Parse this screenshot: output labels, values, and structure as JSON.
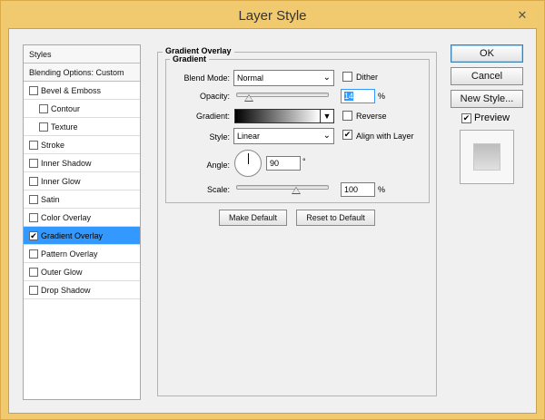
{
  "window": {
    "title": "Layer Style",
    "close_glyph": "✕"
  },
  "left_list": {
    "styles_header": "Styles",
    "blending_header": "Blending Options: Custom",
    "items": [
      {
        "label": "Bevel & Emboss",
        "checked": false,
        "indent": false
      },
      {
        "label": "Contour",
        "checked": false,
        "indent": true
      },
      {
        "label": "Texture",
        "checked": false,
        "indent": true
      },
      {
        "label": "Stroke",
        "checked": false,
        "indent": false
      },
      {
        "label": "Inner Shadow",
        "checked": false,
        "indent": false
      },
      {
        "label": "Inner Glow",
        "checked": false,
        "indent": false
      },
      {
        "label": "Satin",
        "checked": false,
        "indent": false
      },
      {
        "label": "Color Overlay",
        "checked": false,
        "indent": false
      },
      {
        "label": "Gradient Overlay",
        "checked": true,
        "indent": false,
        "selected": true
      },
      {
        "label": "Pattern Overlay",
        "checked": false,
        "indent": false
      },
      {
        "label": "Outer Glow",
        "checked": false,
        "indent": false
      },
      {
        "label": "Drop Shadow",
        "checked": false,
        "indent": false
      }
    ],
    "check_glyph": "✔"
  },
  "panel": {
    "title": "Gradient Overlay",
    "group": "Gradient",
    "blend_mode_label": "Blend Mode:",
    "blend_mode_value": "Normal",
    "dither_label": "Dither",
    "dither_checked": false,
    "opacity_label": "Opacity:",
    "opacity_value": "14",
    "opacity_fraction": 0.14,
    "percent": "%",
    "gradient_label": "Gradient:",
    "reverse_label": "Reverse",
    "reverse_checked": false,
    "style_label": "Style:",
    "style_value": "Linear",
    "align_label": "Align with Layer",
    "align_checked": true,
    "angle_label": "Angle:",
    "angle_value": "90",
    "degree": "°",
    "scale_label": "Scale:",
    "scale_value": "100",
    "scale_fraction": 0.5,
    "make_default": "Make Default",
    "reset_default": "Reset to Default"
  },
  "actions": {
    "ok": "OK",
    "cancel": "Cancel",
    "new_style": "New Style...",
    "preview_label": "Preview",
    "preview_checked": true
  },
  "icons": {
    "dropdown": "chevron-down-icon",
    "close": "close-icon",
    "check": "checkmark-icon"
  },
  "colors": {
    "accent_selection": "#3399ff",
    "window_frame": "#f1c96e"
  }
}
